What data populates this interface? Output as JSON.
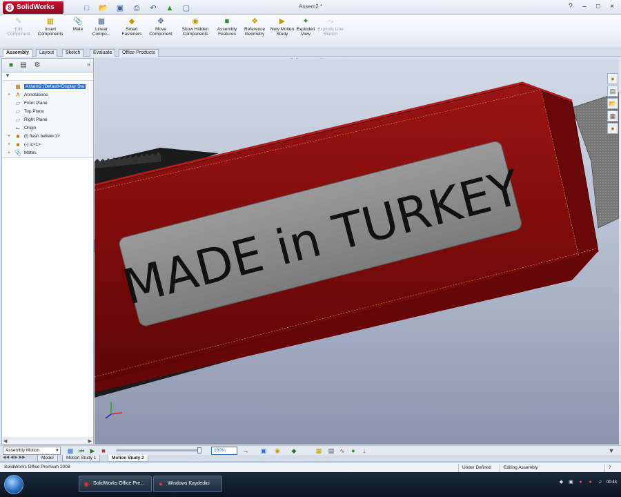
{
  "app": {
    "logo": "SolidWorks",
    "document_title": "Assem2 *"
  },
  "quick_access": [
    "new-icon",
    "open-icon",
    "save-icon",
    "print-icon",
    "undo-icon",
    "rebuild-icon",
    "options-icon"
  ],
  "ribbon": {
    "commands": [
      {
        "label": "Edit Component",
        "icon": "edit-component-icon",
        "disabled": true
      },
      {
        "label": "Insert Components",
        "icon": "insert-components-icon",
        "disabled": false
      },
      {
        "label": "Mate",
        "icon": "mate-icon",
        "disabled": false
      },
      {
        "label": "Linear Compo...",
        "icon": "linear-pattern-icon",
        "disabled": false
      },
      {
        "label": "Smart Fasteners",
        "icon": "smart-fasteners-icon",
        "disabled": false
      },
      {
        "label": "Move Component",
        "icon": "move-component-icon",
        "disabled": false
      },
      {
        "label": "Show Hidden Components",
        "icon": "show-hidden-icon",
        "disabled": false
      },
      {
        "label": "Assembly Features",
        "icon": "assembly-features-icon",
        "disabled": false
      },
      {
        "label": "Reference Geometry",
        "icon": "reference-geometry-icon",
        "disabled": false
      },
      {
        "label": "New Motion Study",
        "icon": "motion-study-icon",
        "disabled": false
      },
      {
        "label": "Exploded View",
        "icon": "exploded-view-icon",
        "disabled": false
      },
      {
        "label": "Explode Line Sketch",
        "icon": "explode-line-icon",
        "disabled": true
      }
    ]
  },
  "tabs": [
    "Assembly",
    "Layout",
    "Sketch",
    "Evaluate",
    "Office Products"
  ],
  "active_tab": "Assembly",
  "feature_tree": {
    "root": "Assem2 (Default<Display Sta",
    "items": [
      {
        "label": "Annotations",
        "icon": "annotations-icon"
      },
      {
        "label": "Front Plane",
        "icon": "plane-icon"
      },
      {
        "label": "Top Plane",
        "icon": "plane-icon"
      },
      {
        "label": "Right Plane",
        "icon": "plane-icon"
      },
      {
        "label": "Origin",
        "icon": "origin-icon"
      },
      {
        "label": "(f) flash bellek<1>",
        "icon": "part-icon"
      },
      {
        "label": "(-) ic<1>",
        "icon": "part-icon"
      },
      {
        "label": "Mates",
        "icon": "mates-icon"
      }
    ]
  },
  "model": {
    "plate_text": "MADE in TURKEY",
    "body_color": "#7e0c0c",
    "plate_color": "#8a8a8a"
  },
  "motion": {
    "study_type": "Assembly Motion",
    "speed": "100%"
  },
  "study_tabs": [
    "Model",
    "Motion Study 1",
    "Motion Study 2"
  ],
  "active_study_tab": "Motion Study 2",
  "status": {
    "text": "SolidWorks Office Premium 2008",
    "state": "Under Defined",
    "mode": "Editing Assembly"
  },
  "taskbar": {
    "buttons": [
      {
        "label": "SolidWorks Office Pre...",
        "icon": "solidworks-icon"
      },
      {
        "label": "Windows Kaydedici",
        "icon": "recorder-icon"
      }
    ],
    "clock": "00:43"
  }
}
